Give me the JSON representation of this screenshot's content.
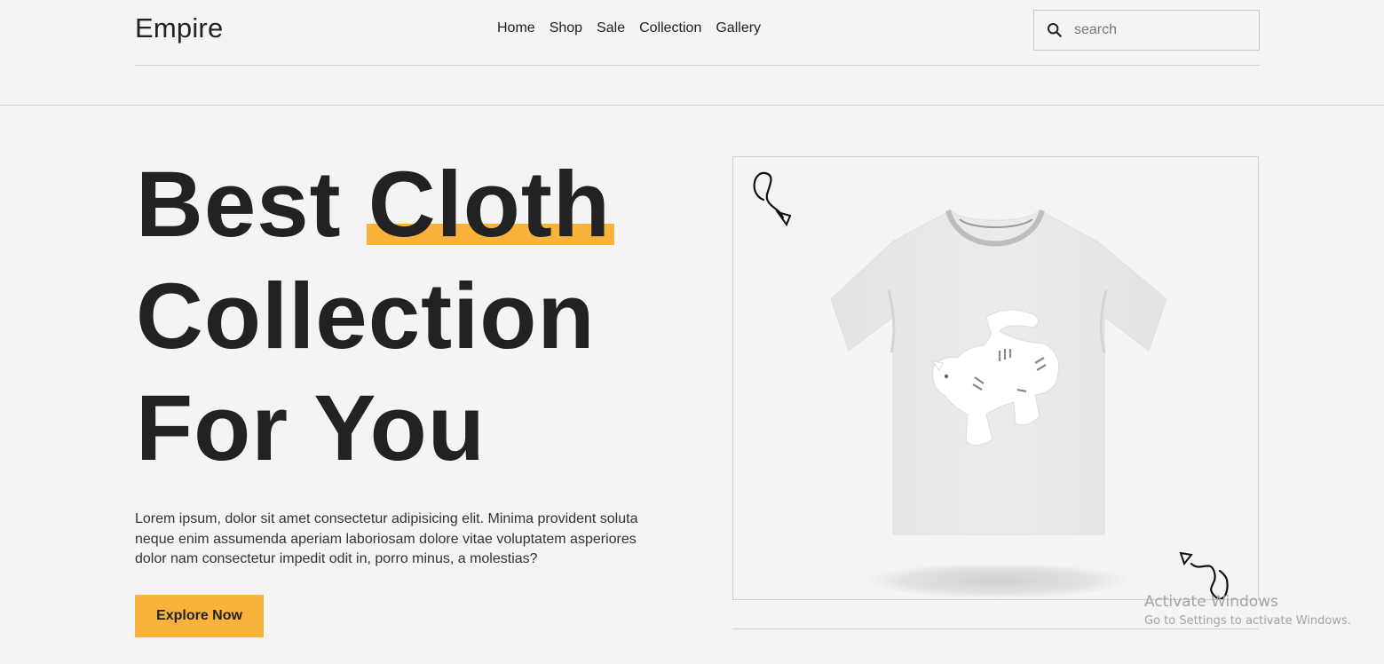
{
  "header": {
    "logo": "Empire",
    "nav": [
      "Home",
      "Shop",
      "Sale",
      "Collection",
      "Gallery"
    ],
    "search_placeholder": "search"
  },
  "hero": {
    "title_line1_a": "Best ",
    "title_line1_highlight": "Cloth",
    "title_line2": "Collection",
    "title_line3": "For You",
    "description": "Lorem ipsum, dolor sit amet consectetur adipisicing elit. Minima provident soluta neque enim assumenda aperiam laboriosam dolore vitae voluptatem asperiores dolor nam consectetur impedit odit in, porro minus, a molestias?",
    "cta_label": "Explore Now"
  },
  "product": {
    "image": "white-tshirt-with-cat-print",
    "decoration_icons": [
      "squiggle-arrow-icon",
      "squiggle-arrow-icon"
    ]
  },
  "watermark": {
    "line1": "Activate Windows",
    "line2": "Go to Settings to activate Windows."
  },
  "colors": {
    "accent": "#f9b33b",
    "background": "#f4f4f4",
    "text": "#222222"
  }
}
